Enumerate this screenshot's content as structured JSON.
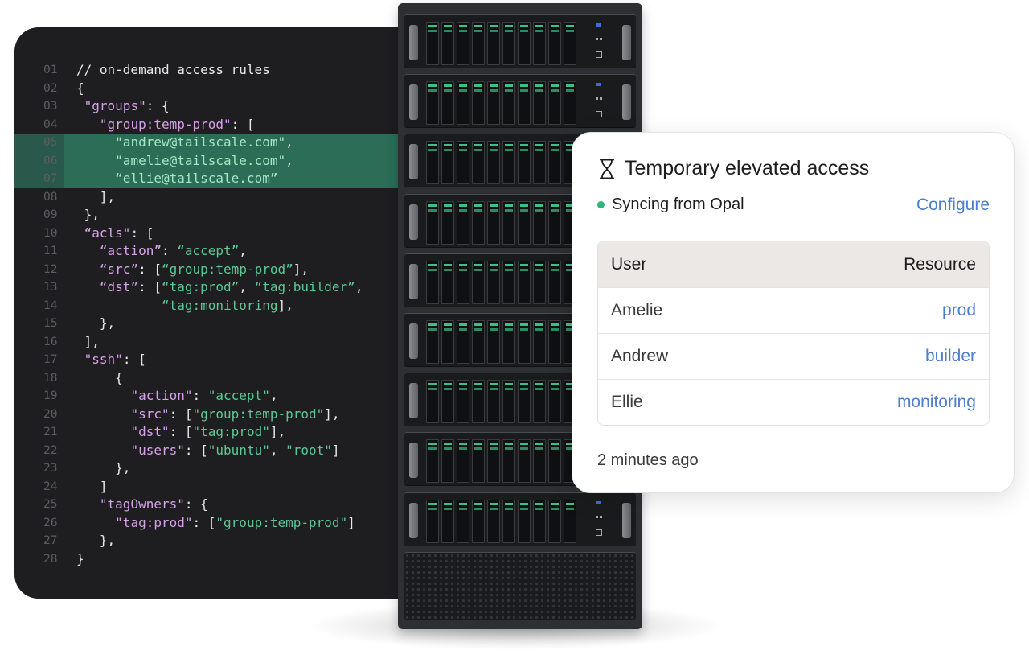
{
  "editor": {
    "lines": [
      {
        "num": "01",
        "parts": [
          {
            "t": "// on-demand access rules",
            "c": "c"
          }
        ]
      },
      {
        "num": "02",
        "parts": [
          {
            "t": "{",
            "c": "c"
          }
        ]
      },
      {
        "num": "03",
        "parts": [
          {
            "t": " ",
            "c": "c"
          },
          {
            "t": "\"groups\"",
            "c": "k"
          },
          {
            "t": ": {",
            "c": "c"
          }
        ]
      },
      {
        "num": "04",
        "parts": [
          {
            "t": "   ",
            "c": "c"
          },
          {
            "t": "\"group:temp-prod\"",
            "c": "k"
          },
          {
            "t": ": [",
            "c": "c"
          }
        ]
      },
      {
        "num": "05",
        "hl": true,
        "parts": [
          {
            "t": "     ",
            "c": "c"
          },
          {
            "t": "\"andrew@tailscale.com\"",
            "c": "s"
          },
          {
            "t": ",",
            "c": "c"
          }
        ]
      },
      {
        "num": "06",
        "hl": true,
        "parts": [
          {
            "t": "     ",
            "c": "c"
          },
          {
            "t": "\"amelie@tailscale.com\"",
            "c": "s"
          },
          {
            "t": ",",
            "c": "c"
          }
        ]
      },
      {
        "num": "07",
        "hl": true,
        "parts": [
          {
            "t": "     ",
            "c": "c"
          },
          {
            "t": "“ellie@tailscale.com”",
            "c": "s"
          }
        ]
      },
      {
        "num": "08",
        "parts": [
          {
            "t": "   ],",
            "c": "c"
          }
        ]
      },
      {
        "num": "09",
        "parts": [
          {
            "t": " },",
            "c": "c"
          }
        ]
      },
      {
        "num": "10",
        "parts": [
          {
            "t": " ",
            "c": "c"
          },
          {
            "t": "“acls\"",
            "c": "k"
          },
          {
            "t": ": [",
            "c": "c"
          }
        ]
      },
      {
        "num": "11",
        "parts": [
          {
            "t": "   ",
            "c": "c"
          },
          {
            "t": "“action”",
            "c": "k"
          },
          {
            "t": ": ",
            "c": "c"
          },
          {
            "t": "“accept”",
            "c": "s"
          },
          {
            "t": ",",
            "c": "c"
          }
        ]
      },
      {
        "num": "12",
        "parts": [
          {
            "t": "   ",
            "c": "c"
          },
          {
            "t": "“src”",
            "c": "k"
          },
          {
            "t": ": [",
            "c": "c"
          },
          {
            "t": "“group:temp-prod”",
            "c": "s"
          },
          {
            "t": "],",
            "c": "c"
          }
        ]
      },
      {
        "num": "13",
        "parts": [
          {
            "t": "   ",
            "c": "c"
          },
          {
            "t": "“dst”",
            "c": "k"
          },
          {
            "t": ": [",
            "c": "c"
          },
          {
            "t": "“tag:prod”",
            "c": "s"
          },
          {
            "t": ", ",
            "c": "c"
          },
          {
            "t": "“tag:builder”",
            "c": "s"
          },
          {
            "t": ",",
            "c": "c"
          }
        ]
      },
      {
        "num": "14",
        "parts": [
          {
            "t": "           ",
            "c": "c"
          },
          {
            "t": "“tag:monitoring",
            "c": "s"
          },
          {
            "t": "],",
            "c": "c"
          }
        ]
      },
      {
        "num": "15",
        "parts": [
          {
            "t": "   },",
            "c": "c"
          }
        ]
      },
      {
        "num": "16",
        "parts": [
          {
            "t": " ],",
            "c": "c"
          }
        ]
      },
      {
        "num": "17",
        "parts": [
          {
            "t": " ",
            "c": "c"
          },
          {
            "t": "\"ssh\"",
            "c": "k"
          },
          {
            "t": ": [",
            "c": "c"
          }
        ]
      },
      {
        "num": "18",
        "parts": [
          {
            "t": "     {",
            "c": "c"
          }
        ]
      },
      {
        "num": "19",
        "parts": [
          {
            "t": "       ",
            "c": "c"
          },
          {
            "t": "\"action\"",
            "c": "k"
          },
          {
            "t": ": ",
            "c": "c"
          },
          {
            "t": "\"accept\"",
            "c": "s"
          },
          {
            "t": ",",
            "c": "c"
          }
        ]
      },
      {
        "num": "20",
        "parts": [
          {
            "t": "       ",
            "c": "c"
          },
          {
            "t": "\"src\"",
            "c": "k"
          },
          {
            "t": ": [",
            "c": "c"
          },
          {
            "t": "\"group:temp-prod\"",
            "c": "s"
          },
          {
            "t": "],",
            "c": "c"
          }
        ]
      },
      {
        "num": "21",
        "parts": [
          {
            "t": "       ",
            "c": "c"
          },
          {
            "t": "\"dst\"",
            "c": "k"
          },
          {
            "t": ": [",
            "c": "c"
          },
          {
            "t": "\"tag:prod\"",
            "c": "s"
          },
          {
            "t": "],",
            "c": "c"
          }
        ]
      },
      {
        "num": "22",
        "parts": [
          {
            "t": "       ",
            "c": "c"
          },
          {
            "t": "\"users\"",
            "c": "k"
          },
          {
            "t": ": [",
            "c": "c"
          },
          {
            "t": "\"ubuntu\"",
            "c": "s"
          },
          {
            "t": ", ",
            "c": "c"
          },
          {
            "t": "\"root\"",
            "c": "s"
          },
          {
            "t": "]",
            "c": "c"
          }
        ]
      },
      {
        "num": "23",
        "parts": [
          {
            "t": "     },",
            "c": "c"
          }
        ]
      },
      {
        "num": "24",
        "parts": [
          {
            "t": "   ]",
            "c": "c"
          }
        ]
      },
      {
        "num": "25",
        "parts": [
          {
            "t": "   ",
            "c": "c"
          },
          {
            "t": "\"tagOwners\"",
            "c": "k"
          },
          {
            "t": ": {",
            "c": "c"
          }
        ]
      },
      {
        "num": "26",
        "parts": [
          {
            "t": "     ",
            "c": "c"
          },
          {
            "t": "\"tag:prod\"",
            "c": "k"
          },
          {
            "t": ": [",
            "c": "c"
          },
          {
            "t": "\"group:temp-prod\"",
            "c": "s"
          },
          {
            "t": "]",
            "c": "c"
          }
        ]
      },
      {
        "num": "27",
        "parts": [
          {
            "t": "   },",
            "c": "c"
          }
        ]
      },
      {
        "num": "28",
        "parts": [
          {
            "t": "}",
            "c": "c"
          }
        ]
      }
    ]
  },
  "card": {
    "title": "Temporary elevated access",
    "title_icon": "hourglass-icon",
    "status_text": "Syncing from Opal",
    "status_color": "#2fb57b",
    "configure_label": "Configure",
    "table": {
      "headers": [
        "User",
        "Resource"
      ],
      "rows": [
        {
          "user": "Amelie",
          "resource": "prod"
        },
        {
          "user": "Andrew",
          "resource": "builder"
        },
        {
          "user": "Ellie",
          "resource": "monitoring"
        }
      ]
    },
    "timestamp": "2 minutes ago"
  },
  "colors": {
    "editor_bg": "#1e1e20",
    "highlight": "#2b6d57",
    "link": "#4c7ed0",
    "key": "#d7a2e8",
    "string": "#5ec795"
  }
}
